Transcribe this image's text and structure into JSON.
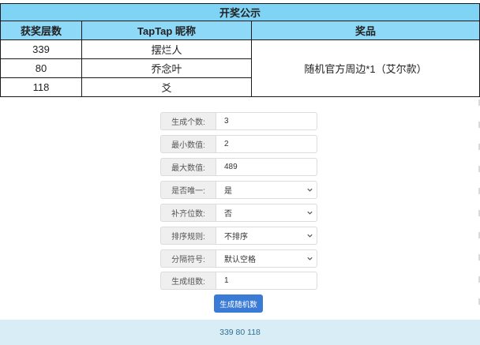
{
  "table": {
    "title": "开奖公示",
    "headers": [
      "获奖层数",
      "TapTap 昵称",
      "奖品"
    ],
    "rows": [
      {
        "floor": "339",
        "nickname": "摆烂人"
      },
      {
        "floor": "80",
        "nickname": "乔念叶"
      },
      {
        "floor": "118",
        "nickname": "爻"
      }
    ],
    "prize": "随机官方周边*1（艾尔款）"
  },
  "form": {
    "count": {
      "label": "生成个数:",
      "value": "3"
    },
    "min": {
      "label": "最小数值:",
      "value": "2"
    },
    "max": {
      "label": "最大数值:",
      "value": "489"
    },
    "unique": {
      "label": "是否唯一:",
      "value": "是"
    },
    "pad": {
      "label": "补齐位数:",
      "value": "否"
    },
    "sort": {
      "label": "排序规则:",
      "value": "不排序"
    },
    "separator": {
      "label": "分隔符号:",
      "value": "默认空格"
    },
    "groups": {
      "label": "生成组数:",
      "value": "1"
    }
  },
  "button": {
    "label": "生成随机数"
  },
  "output": {
    "text": "339 80 118"
  }
}
